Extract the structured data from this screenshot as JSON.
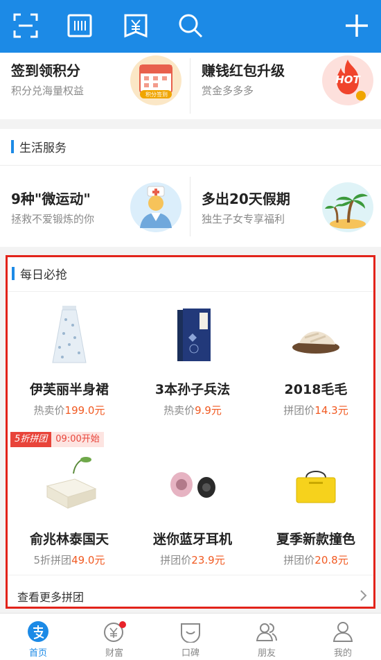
{
  "topbar": {
    "icons": [
      "scan-icon",
      "barcode-pay-icon",
      "yuan-bill-icon",
      "search-icon",
      "plus-icon"
    ],
    "bg": "#1c8ae6"
  },
  "promo_row": [
    {
      "title": "签到领积分",
      "subtitle": "积分兑海量权益",
      "badge": "积分签到"
    },
    {
      "title": "赚钱红包升级",
      "subtitle": "赏金多多多",
      "badge": "HOT"
    }
  ],
  "life_service": {
    "title": "生活服务",
    "items": [
      {
        "title": "9种\"微运动\"",
        "subtitle": "拯救不爱锻炼的你"
      },
      {
        "title": "多出20天假期",
        "subtitle": "独生子女专享福利"
      }
    ]
  },
  "daily_deals": {
    "title": "每日必抢",
    "row1": [
      {
        "name": "伊芙丽半身裙",
        "price_label": "热卖价",
        "price": "199.0元"
      },
      {
        "name": "3本孙子兵法",
        "price_label": "热卖价",
        "price": "9.9元"
      },
      {
        "name": "2018毛毛",
        "price_label": "拼团价",
        "price": "14.3元"
      }
    ],
    "group_badge": "5折拼团",
    "group_time": "09:00开始",
    "row2": [
      {
        "name": "俞兆林泰国天",
        "price_label": "5折拼团",
        "price": "49.0元"
      },
      {
        "name": "迷你蓝牙耳机",
        "price_label": "拼团价",
        "price": "23.9元"
      },
      {
        "name": "夏季新款撞色",
        "price_label": "拼团价",
        "price": "20.8元"
      }
    ],
    "more_link": "查看更多拼团"
  },
  "tabbar": {
    "tabs": [
      {
        "label": "首页",
        "icon": "alipay-home-icon",
        "active": true
      },
      {
        "label": "财富",
        "icon": "wealth-icon",
        "active": false
      },
      {
        "label": "口碑",
        "icon": "koubei-icon",
        "active": false
      },
      {
        "label": "朋友",
        "icon": "friends-icon",
        "active": false
      },
      {
        "label": "我的",
        "icon": "profile-icon",
        "active": false
      }
    ]
  },
  "colors": {
    "accent": "#1c8ae6",
    "price": "#f15a22",
    "highlight_border": "#e2231a"
  }
}
